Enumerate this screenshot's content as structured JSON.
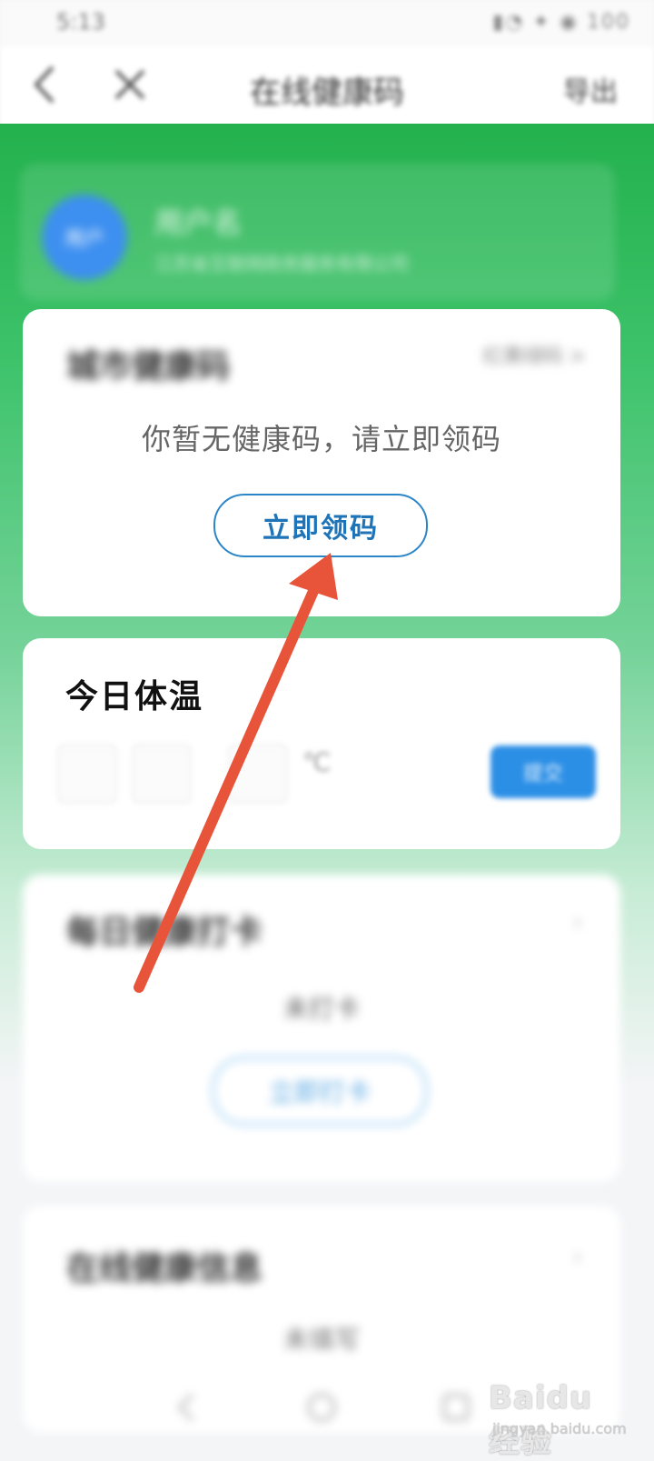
{
  "status_bar": {
    "time": "5:13",
    "icons": "▮◔ ✦ ◉ 100"
  },
  "header": {
    "title": "在线健康码",
    "right_label": "导出"
  },
  "user": {
    "avatar_text": "用户",
    "name": "用户名",
    "subtitle": "江苏省互联网政务服务有限公司"
  },
  "health_code_card": {
    "title": "城市健康码",
    "right_label": "红黄绿码 >",
    "empty_message": "你暂无健康码，请立即领码",
    "claim_button": "立即领码"
  },
  "temperature_card": {
    "title": "今日体温",
    "unit": "℃",
    "submit": "提交"
  },
  "checkin_card": {
    "title": "每日健康打卡",
    "status": "未打卡",
    "button": "立即打卡"
  },
  "info_card": {
    "title": "在线健康信息",
    "status": "未填写"
  },
  "watermark": {
    "logo": "Baidu经验",
    "sub": "jingyan.baidu.com"
  },
  "annotation": {
    "arrow_color": "#e8543a"
  }
}
